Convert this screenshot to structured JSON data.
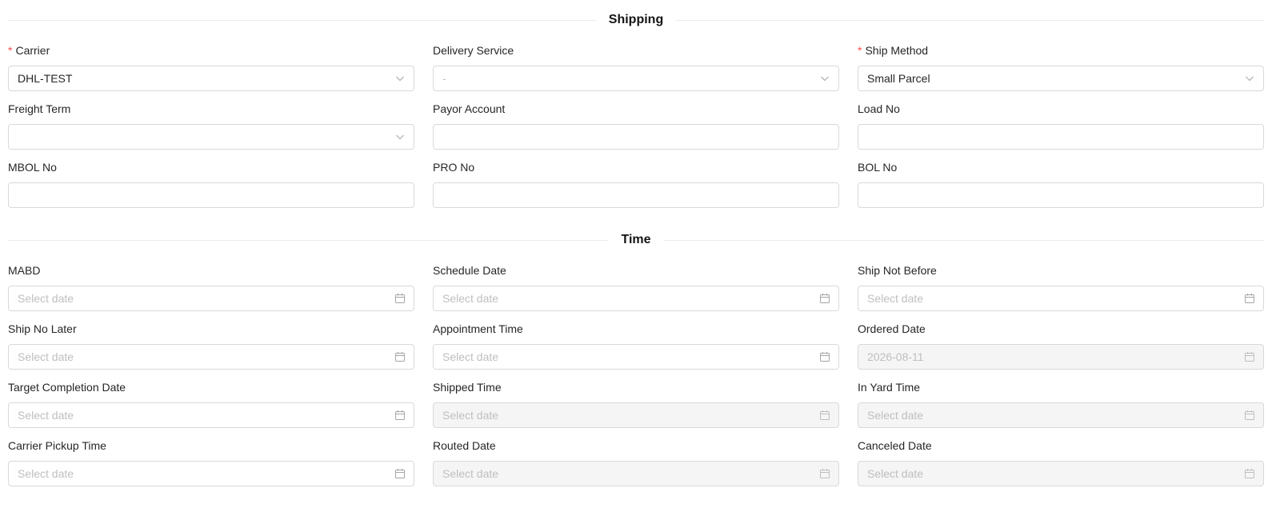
{
  "sections": {
    "shipping_title": "Shipping",
    "time_title": "Time"
  },
  "shipping": {
    "carrier": {
      "label": "Carrier",
      "value": "DHL-TEST"
    },
    "delivery_service": {
      "label": "Delivery Service",
      "value": "-"
    },
    "ship_method": {
      "label": "Ship Method",
      "value": "Small Parcel"
    },
    "freight_term": {
      "label": "Freight Term",
      "value": ""
    },
    "payor_account": {
      "label": "Payor Account",
      "value": ""
    },
    "load_no": {
      "label": "Load No",
      "value": ""
    },
    "mbol_no": {
      "label": "MBOL No",
      "value": ""
    },
    "pro_no": {
      "label": "PRO No",
      "value": ""
    },
    "bol_no": {
      "label": "BOL No",
      "value": ""
    }
  },
  "time": {
    "placeholder": "Select date",
    "mabd": {
      "label": "MABD"
    },
    "schedule_date": {
      "label": "Schedule Date"
    },
    "ship_not_before": {
      "label": "Ship Not Before"
    },
    "ship_no_later": {
      "label": "Ship No Later"
    },
    "appointment_time": {
      "label": "Appointment Time"
    },
    "ordered_date": {
      "label": "Ordered Date",
      "value": "2026-08-11"
    },
    "target_completion_date": {
      "label": "Target Completion Date"
    },
    "shipped_time": {
      "label": "Shipped Time"
    },
    "in_yard_time": {
      "label": "In Yard Time"
    },
    "carrier_pickup_time": {
      "label": "Carrier Pickup Time"
    },
    "routed_date": {
      "label": "Routed Date"
    },
    "canceled_date": {
      "label": "Canceled Date"
    }
  },
  "colors": {
    "required_mark": "#ff4d4f",
    "border": "#d9d9d9",
    "disabled_bg": "#f5f5f5",
    "placeholder": "#bfbfbf"
  },
  "icons": {
    "select_suffix": "chevron-down-icon",
    "date_suffix": "calendar-icon"
  },
  "required_mark": "*"
}
